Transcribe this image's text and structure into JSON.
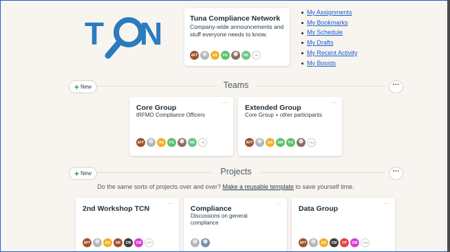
{
  "headquarters": {
    "title": "Tuna Compliance Network",
    "description": "Company-wide announcements and stuff everyone needs to know.",
    "avatars": [
      {
        "initials": "AFT",
        "color": "#a0522d"
      },
      {
        "initials": "",
        "color": "#b0b8bc",
        "photo": true
      },
      {
        "initials": "AA",
        "color": "#f2b12a"
      },
      {
        "initials": "FG",
        "color": "#5cc26b"
      },
      {
        "initials": "",
        "color": "#8d6e63",
        "photo": true
      },
      {
        "initials": "HK",
        "color": "#6cc48a"
      }
    ],
    "more": "+6"
  },
  "links": [
    {
      "label": "My Assignments"
    },
    {
      "label": "My Bookmarks"
    },
    {
      "label": "My Schedule"
    },
    {
      "label": "My Drafts"
    },
    {
      "label": "My Recent Activity"
    },
    {
      "label": "My Boosts"
    }
  ],
  "teams": {
    "new_label": "New",
    "heading": "Teams",
    "cards": [
      {
        "title": "Core Group",
        "description": "tRFMO Compliance Officers",
        "avatars": [
          {
            "initials": "AFT",
            "color": "#a0522d"
          },
          {
            "initials": "",
            "color": "#b0b8bc",
            "photo": true
          },
          {
            "initials": "AA",
            "color": "#f2b12a"
          },
          {
            "initials": "FG",
            "color": "#5cc26b"
          },
          {
            "initials": "",
            "color": "#8d6e63",
            "photo": true
          },
          {
            "initials": "HK",
            "color": "#6cc48a"
          }
        ],
        "more": "+6"
      },
      {
        "title": "Extended Group",
        "description": "Core Group + other participants",
        "avatars": [
          {
            "initials": "AFT",
            "color": "#a0522d"
          },
          {
            "initials": "",
            "color": "#b0b8bc",
            "photo": true
          },
          {
            "initials": "AA",
            "color": "#f2b12a"
          },
          {
            "initials": "EM",
            "color": "#5cc26b"
          },
          {
            "initials": "FG",
            "color": "#5cc26b"
          },
          {
            "initials": "",
            "color": "#8d6e63",
            "photo": true
          }
        ],
        "more": "+14"
      }
    ]
  },
  "projects": {
    "new_label": "New",
    "heading": "Projects",
    "hint_before": "Do the same sorts of projects over and over? ",
    "hint_link": "Make a reusable template",
    "hint_after": " to save yourself time.",
    "cards": [
      {
        "title": "2nd Workshop TCN",
        "description": "",
        "avatars": [
          {
            "initials": "AFT",
            "color": "#a0522d"
          },
          {
            "initials": "",
            "color": "#b0b8bc",
            "photo": true
          },
          {
            "initials": "AA",
            "color": "#f2b12a"
          },
          {
            "initials": "AR",
            "color": "#a0522d"
          },
          {
            "initials": "CM",
            "color": "#3d3d3d"
          },
          {
            "initials": "CM",
            "color": "#d63fd6"
          }
        ],
        "more": "+27"
      },
      {
        "title": "Compliance",
        "description": "Discussions on general compliance",
        "avatars": [
          {
            "initials": "",
            "color": "#b0b8bc",
            "photo": true
          },
          {
            "initials": "",
            "color": "#6f8fae",
            "photo": true
          }
        ],
        "more": ""
      },
      {
        "title": "Data Group",
        "description": "",
        "avatars": [
          {
            "initials": "AFT",
            "color": "#a0522d"
          },
          {
            "initials": "",
            "color": "#b0b8bc",
            "photo": true
          },
          {
            "initials": "AA",
            "color": "#f2b12a"
          },
          {
            "initials": "CM",
            "color": "#3d3d3d"
          },
          {
            "initials": "CP",
            "color": "#e0413a"
          },
          {
            "initials": "CM",
            "color": "#d63fd6"
          }
        ],
        "more": "+14"
      }
    ]
  },
  "colors": {
    "accent": "#2f9a52",
    "link": "#1a5fd0",
    "logo": "#2c7bbf"
  }
}
